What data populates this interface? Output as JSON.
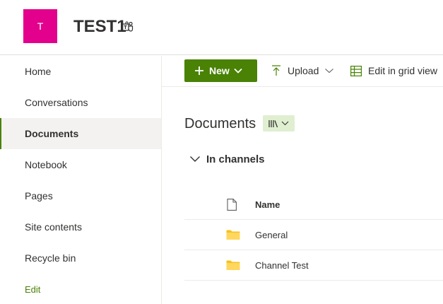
{
  "header": {
    "logo_letter": "T",
    "site_title": "TEST1",
    "brand_color": "#e3008c",
    "teams_icon": "teams-icon"
  },
  "nav": {
    "items": [
      {
        "label": "Home"
      },
      {
        "label": "Conversations"
      },
      {
        "label": "Documents",
        "selected": true
      },
      {
        "label": "Notebook"
      },
      {
        "label": "Pages"
      },
      {
        "label": "Site contents"
      },
      {
        "label": "Recycle bin"
      }
    ],
    "edit_label": "Edit",
    "accent_color": "#498205"
  },
  "commandbar": {
    "new_label": "New",
    "upload_label": "Upload",
    "grid_label": "Edit in grid view"
  },
  "library": {
    "title": "Documents",
    "view_icon": "library-view-icon",
    "group_label": "In channels",
    "columns": {
      "name": "Name"
    },
    "rows": [
      {
        "name": "General",
        "icon": "folder-icon"
      },
      {
        "name": "Channel Test",
        "icon": "folder-icon"
      }
    ]
  }
}
